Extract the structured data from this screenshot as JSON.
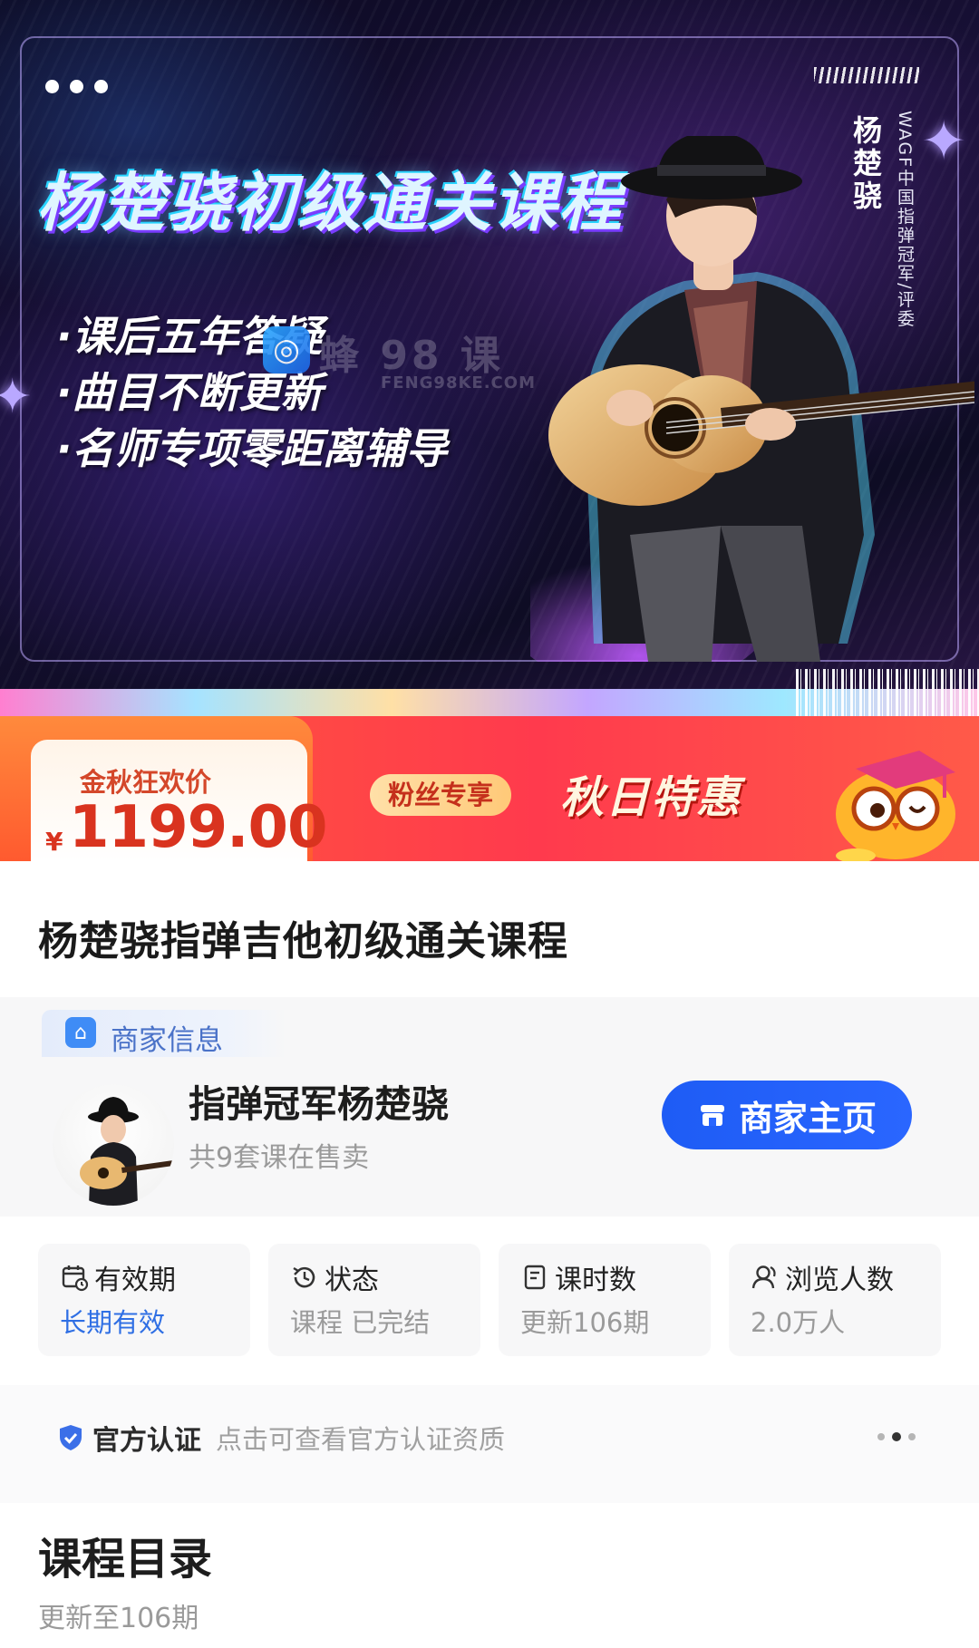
{
  "banner": {
    "title": "杨楚骁初级通关课程",
    "bullets": [
      "·课后五年答疑",
      "·曲目不断更新",
      "·名师专项零距离辅导"
    ],
    "vertical_name": "杨楚骁",
    "vertical_subtitle": "WAGF中国指弹冠军/评委",
    "watermark": "蜂 98 课",
    "watermark_small": "FENG98KE.COM",
    "more_icon": "more-dots-icon"
  },
  "promo": {
    "price_label": "金秋狂欢价",
    "currency": "¥",
    "price": "1199.00",
    "fans_tag": "粉丝专享",
    "title": "秋日特惠"
  },
  "course": {
    "title": "杨楚骁指弹吉他初级通关课程"
  },
  "merchant": {
    "tag": "商家信息",
    "name": "指弹冠军杨楚骁",
    "subtitle": "共9套课在售卖",
    "button_label": "商家主页"
  },
  "stats": [
    {
      "label": "有效期",
      "value": "长期有效",
      "icon": "calendar-icon"
    },
    {
      "label": "状态",
      "value": "课程 已完结",
      "icon": "history-icon"
    },
    {
      "label": "课时数",
      "value": "更新106期",
      "icon": "document-icon"
    },
    {
      "label": "浏览人数",
      "value": "2.0万人",
      "icon": "user-icon"
    }
  ],
  "certification": {
    "title": "官方认证",
    "text": "点击可查看官方认证资质"
  },
  "catalog": {
    "title": "课程目录",
    "subtitle": "更新至106期"
  },
  "colors": {
    "accent_blue": "#2a66ff",
    "price_red": "#d9331f",
    "promo_red": "#ff3a4d"
  }
}
